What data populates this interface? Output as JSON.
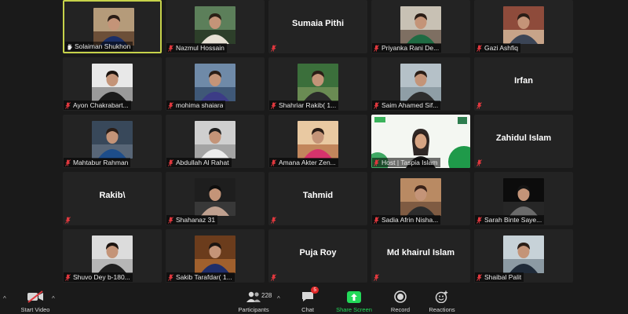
{
  "participants_grid": [
    {
      "label": "Solaiman Shukhon",
      "active": true,
      "photo": "portrait-bookshelf",
      "label_icon": "hand"
    },
    {
      "label": "Nazmul Hossain",
      "photo": "portrait-outdoor"
    },
    {
      "label": "",
      "name": "Sumaia Pithi"
    },
    {
      "label": "Priyanka Rani De...",
      "photo": "portrait-saree"
    },
    {
      "label": "Gazi Ashfiq",
      "photo": "portrait-wall"
    },
    {
      "label": "Ayon Chakrabart...",
      "photo": "portrait-dark"
    },
    {
      "label": "mohima shaiara",
      "photo": "portrait-blue"
    },
    {
      "label": "Shahriar Rakib( 1...",
      "photo": "portrait-green"
    },
    {
      "label": "Saim Ahamed Sif...",
      "photo": "portrait-sky"
    },
    {
      "label": "",
      "name": "Irfan"
    },
    {
      "label": "Mahtabur Rahman",
      "photo": "portrait-desk"
    },
    {
      "label": "Abdullah Al Rahat",
      "photo": "portrait-standing"
    },
    {
      "label": "Amana Akter Zen...",
      "photo": "portrait-hijab"
    },
    {
      "label": "Host | Taspia Islam",
      "photo": "host-banner",
      "wide": true
    },
    {
      "label": "",
      "name": "Zahidul Islam"
    },
    {
      "label": "",
      "name": "Rakib\\"
    },
    {
      "label": "Shahanaz 31",
      "photo": "portrait-night"
    },
    {
      "label": "",
      "name": "Tahmid"
    },
    {
      "label": "Sadia Afrin Nisha...",
      "photo": "portrait-sunny"
    },
    {
      "label": "Sarah Binte Saye...",
      "photo": "portrait-shadow"
    },
    {
      "label": "Shuvo Dey b-180...",
      "photo": "portrait-cap"
    },
    {
      "label": "Sakib Tarafdar( 1...",
      "photo": "portrait-warm"
    },
    {
      "label": "",
      "name": "Puja Roy"
    },
    {
      "label": "",
      "name": "Md khairul Islam"
    },
    {
      "label": "Shaibal Palit",
      "photo": "portrait-street"
    }
  ],
  "toolbar": {
    "start_video": "Start Video",
    "participants": "Participants",
    "participants_count": "228",
    "chat": "Chat",
    "chat_badge": "5",
    "share_screen": "Share Screen",
    "record": "Record",
    "reactions": "Reactions"
  },
  "colors": {
    "background": "#1a1a1a",
    "tile": "#232323",
    "active_speaker_border": "#c6d24a",
    "muted_icon": "#e0383e",
    "share_screen": "#23d959"
  },
  "icons": {
    "muted": "mic-off-icon",
    "hand": "raised-hand-icon",
    "video": "video-off-icon",
    "participants": "people-icon",
    "chat": "chat-bubble-icon",
    "share": "share-screen-icon",
    "record": "record-icon",
    "reactions": "emoji-plus-icon"
  }
}
